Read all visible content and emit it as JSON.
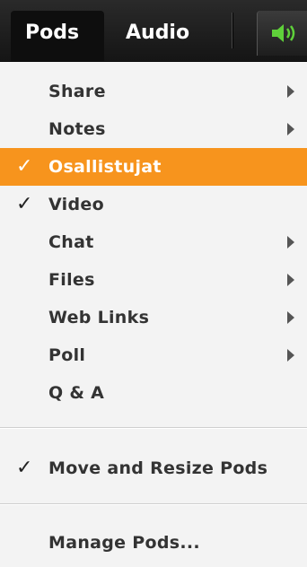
{
  "menubar": {
    "pods_label": "Pods",
    "audio_label": "Audio",
    "speaker_icon": "speaker-volume-icon",
    "speaker_color": "#5fd13a"
  },
  "dropdown": {
    "accent_color": "#f7941d",
    "items": [
      {
        "label": "Share",
        "checked": false,
        "submenu": true,
        "highlighted": false
      },
      {
        "label": "Notes",
        "checked": false,
        "submenu": true,
        "highlighted": false
      },
      {
        "label": "Osallistujat",
        "checked": true,
        "submenu": false,
        "highlighted": true
      },
      {
        "label": "Video",
        "checked": true,
        "submenu": false,
        "highlighted": false
      },
      {
        "label": "Chat",
        "checked": false,
        "submenu": true,
        "highlighted": false
      },
      {
        "label": "Files",
        "checked": false,
        "submenu": true,
        "highlighted": false
      },
      {
        "label": "Web Links",
        "checked": false,
        "submenu": true,
        "highlighted": false
      },
      {
        "label": "Poll",
        "checked": false,
        "submenu": true,
        "highlighted": false
      },
      {
        "label": "Q & A",
        "checked": false,
        "submenu": false,
        "highlighted": false
      }
    ],
    "move_resize": {
      "label": "Move and Resize Pods",
      "checked": true
    },
    "manage": {
      "label": "Manage Pods..."
    }
  }
}
